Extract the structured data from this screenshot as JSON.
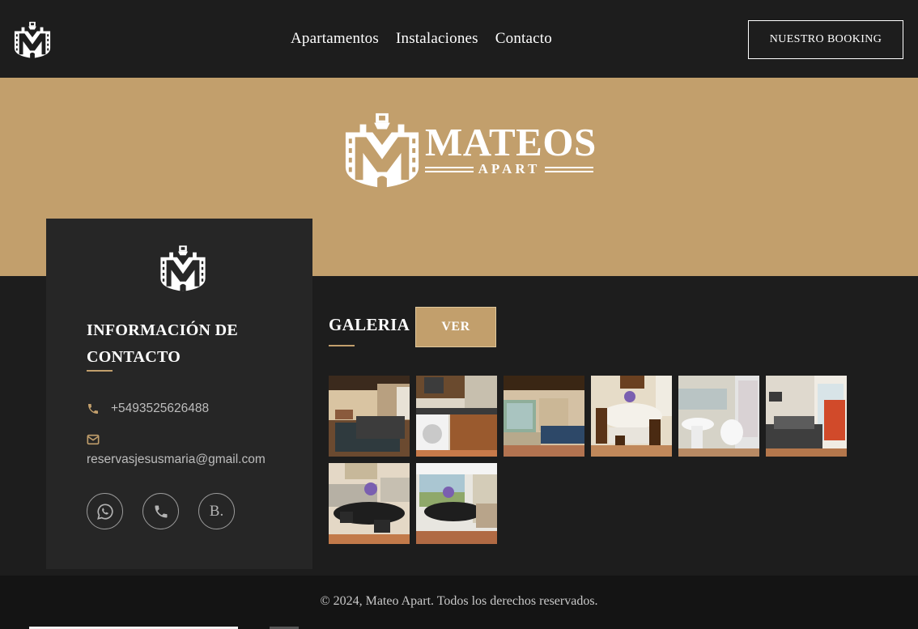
{
  "nav": {
    "links": [
      "Apartamentos",
      "Instalaciones",
      "Contacto"
    ],
    "booking_label": "NUESTRO BOOKING"
  },
  "hero": {
    "brand_title": "MATEOS",
    "brand_subtitle": "APART"
  },
  "contact": {
    "title": "INFORMACIÓN DE CONTACTO",
    "phone": "+5493525626488",
    "email": "reservasjesusmaria@gmail.com",
    "socials": [
      {
        "icon": "whatsapp-icon"
      },
      {
        "icon": "phone-icon"
      },
      {
        "icon": "booking-icon",
        "label": "B."
      }
    ]
  },
  "gallery": {
    "title": "GALERIA",
    "button_label": "VER",
    "photos": [
      {
        "scene": "living-room-with-bed"
      },
      {
        "scene": "kitchen-with-washer"
      },
      {
        "scene": "open-living-area"
      },
      {
        "scene": "dining-table"
      },
      {
        "scene": "bathroom"
      },
      {
        "scene": "bedroom-with-balcony"
      },
      {
        "scene": "dining-glass-table"
      },
      {
        "scene": "dining-near-window"
      }
    ]
  },
  "footer": {
    "copyright": "© 2024, Mateo Apart. Todos los derechos reservados."
  },
  "colors": {
    "background": "#1d1d1d",
    "card": "#262626",
    "accent_gold": "#c29f6c",
    "footer": "#141414"
  }
}
